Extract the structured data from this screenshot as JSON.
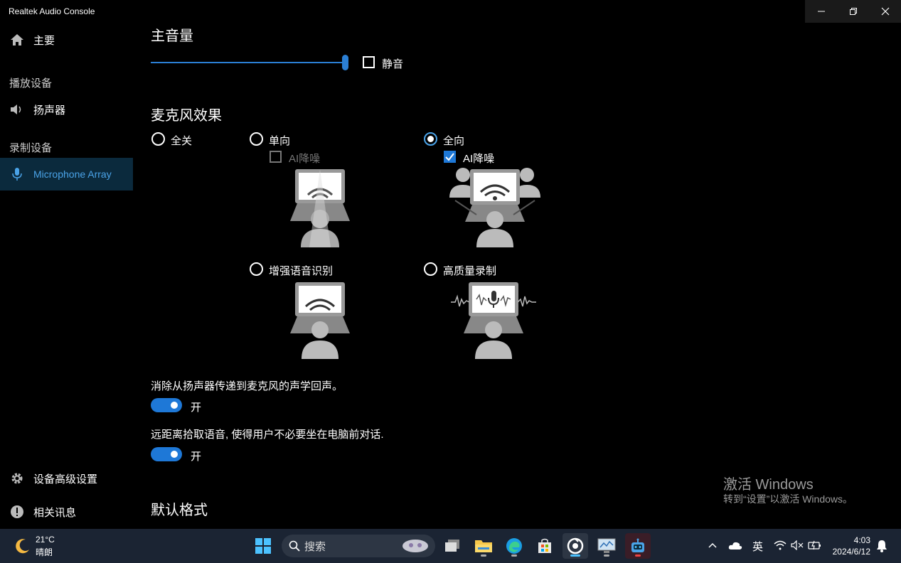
{
  "window": {
    "title": "Realtek Audio Console"
  },
  "sidebar": {
    "home": "主要",
    "playback_section": "播放设备",
    "speakers": "扬声器",
    "recording_section": "录制设备",
    "mic_array": "Microphone Array",
    "advanced": "设备高级设置",
    "info": "相关讯息"
  },
  "main": {
    "master_volume_title": "主音量",
    "volume_level_percent": 100,
    "mute_label": "静音",
    "mic_effects_title": "麦克风效果",
    "options": {
      "all_off": "全关",
      "unidirectional": "单向",
      "uni_ai_noise": "AI降噪",
      "omnidirectional": "全向",
      "omni_ai_noise": "AI降噪",
      "speech_recognition": "增强语音识别",
      "hq_recording": "高质量录制"
    },
    "echo_cancel_desc": "消除从扬声器传递到麦克风的声学回声。",
    "echo_cancel_state": "开",
    "far_field_desc": "远距离拾取语音, 使得用户不必要坐在电脑前对话.",
    "far_field_state": "开",
    "default_format_title": "默认格式"
  },
  "watermark": {
    "line1": "激活 Windows",
    "line2": "转到“设置”以激活 Windows。"
  },
  "taskbar": {
    "weather_temp": "21°C",
    "weather_desc": "晴朗",
    "search_placeholder": "搜索",
    "ime": "英",
    "time": "4:03",
    "date": "2024/6/12"
  },
  "colors": {
    "accent": "#1e78d7",
    "selected": "#4aa3e8",
    "taskbar": "#1b2433"
  }
}
